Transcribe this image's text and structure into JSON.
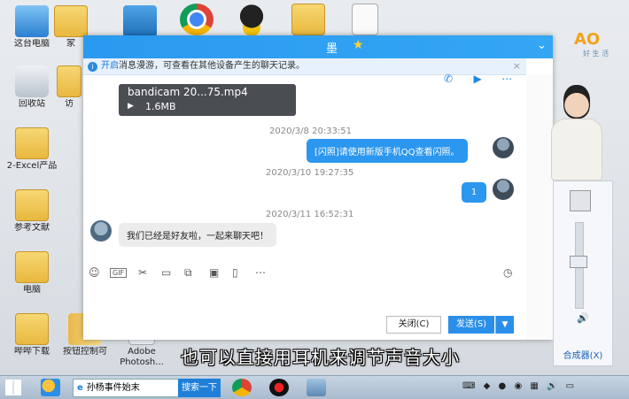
{
  "desktop": {
    "icons": [
      {
        "label": "这台电脑",
        "kind": "pc"
      },
      {
        "label": "家",
        "kind": "folder"
      },
      {
        "label": "",
        "kind": "screen"
      },
      {
        "label": "",
        "kind": "chrome"
      },
      {
        "label": "",
        "kind": "qq"
      },
      {
        "label": "",
        "kind": "folder"
      },
      {
        "label": "",
        "kind": "doc"
      },
      {
        "label": "回收站",
        "kind": "bin"
      },
      {
        "label": "访",
        "kind": "folder"
      },
      {
        "label": "2-Excel产品",
        "kind": "folder"
      },
      {
        "label": "参考文献",
        "kind": "folder"
      },
      {
        "label": "电脑",
        "kind": "folder"
      },
      {
        "label": "哔哔下载",
        "kind": "folder"
      },
      {
        "label": "按钮控制可",
        "kind": "jar"
      },
      {
        "label": "Adobe",
        "kind": "doc"
      },
      {
        "label": "Photosh...",
        "kind": "doc"
      }
    ]
  },
  "qq_window": {
    "title": "墨",
    "notice": {
      "link": "开启",
      "text": "消息漫游，可查看在其他设备产生的聊天记录。",
      "close": "×"
    },
    "top_tools": [
      "phone-icon",
      "video-icon",
      "more-icon"
    ],
    "file_card": {
      "name": "bandicam 20...75.mp4",
      "size": "1.6MB"
    },
    "messages": [
      {
        "timestamp": "2020/3/8 20:33:51",
        "side": "me",
        "text": "[闪照]请使用新版手机QQ查看闪照。"
      },
      {
        "timestamp": "2020/3/10 19:27:35",
        "side": "me",
        "text": "1"
      },
      {
        "timestamp": "2020/3/11 16:52:31",
        "side": "other",
        "text": "我们已经是好友啦，一起来聊天吧！"
      }
    ],
    "input_toolbar": {
      "items": [
        "smile-icon",
        "GIF",
        "scissors-icon",
        "folder-icon",
        "pictures-icon",
        "image-icon",
        "screen-record-icon",
        "more-icon",
        "clock-icon"
      ]
    },
    "buttons": {
      "close": "关闭(C)",
      "send": "发送(S)",
      "send_arrow": "▼"
    }
  },
  "volume_panel": {
    "level": 0.55,
    "mixer": "合成器(X)"
  },
  "subtitle": "也可以直接用耳机来调节声音大小",
  "logo": {
    "text": "AO",
    "sub": "好 生 活"
  },
  "taskbar": {
    "search_text": "孙杨事件始末",
    "search_button": "搜索一下",
    "apps": [
      "chrome",
      "record",
      "bird"
    ]
  }
}
